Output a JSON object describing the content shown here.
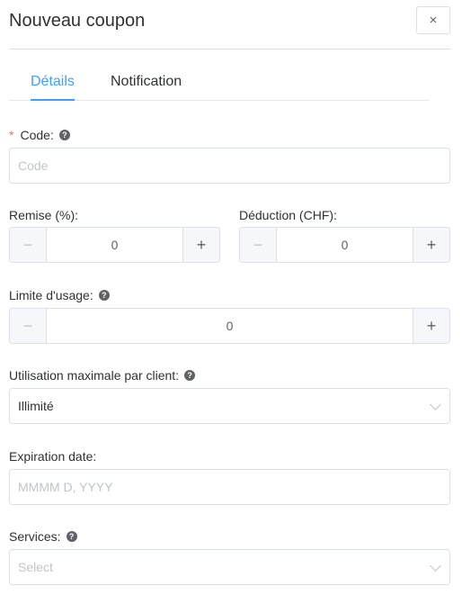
{
  "dialog": {
    "title": "Nouveau coupon",
    "close_symbol": "×"
  },
  "tabs": [
    {
      "label": "Détails",
      "active": true
    },
    {
      "label": "Notification",
      "active": false
    }
  ],
  "form": {
    "code": {
      "label": "Code:",
      "required_mark": "*",
      "placeholder": "Code",
      "value": ""
    },
    "discount": {
      "label": "Remise (%):",
      "value": "0"
    },
    "deduction": {
      "label": "Déduction (CHF):",
      "value": "0"
    },
    "usage_limit": {
      "label": "Limite d'usage:",
      "value": "0"
    },
    "max_per_client": {
      "label": "Utilisation maximale par client:",
      "selected": "Illimité"
    },
    "expiration": {
      "label": "Expiration date:",
      "placeholder": "MMMM D, YYYY"
    },
    "services": {
      "label": "Services:",
      "placeholder": "Select"
    }
  },
  "stepper": {
    "minus_symbol": "−",
    "plus_symbol": "+"
  },
  "help_icon_symbol": "?",
  "colors": {
    "accent": "#409eff",
    "required": "#f56c6c",
    "border": "#dcdfe6",
    "placeholder": "#c0c4cc"
  }
}
